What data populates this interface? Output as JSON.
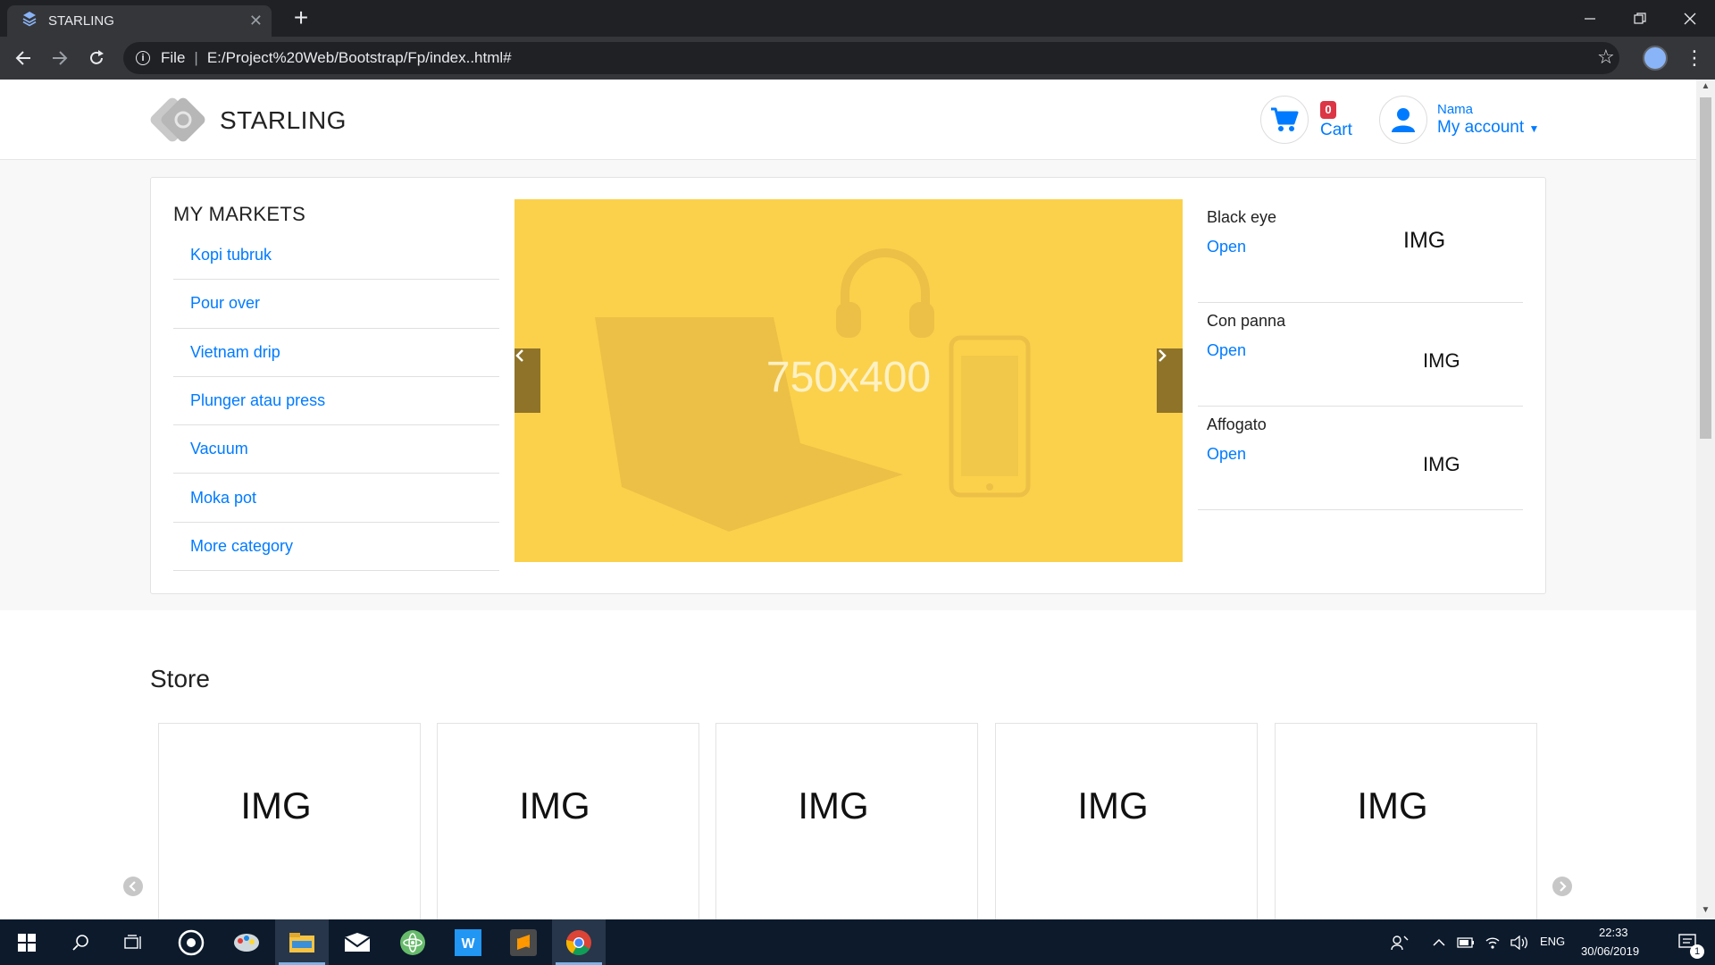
{
  "browser": {
    "tab_title": "STARLING",
    "tab_close": "✕",
    "new_tab": "+",
    "protocol": "File",
    "separator": "|",
    "url": "E:/Project%20Web/Bootstrap/Fp/index..html#",
    "icons": [
      "site-favicon",
      "back-icon",
      "forward-icon",
      "reload-icon",
      "info-icon",
      "star-icon",
      "profile-icon",
      "menu-icon",
      "minimize-icon",
      "restore-icon",
      "close-icon"
    ]
  },
  "header": {
    "brand": "STARLING",
    "cart_count": "0",
    "cart_label": "Cart",
    "account_name": "Nama",
    "account_label": "My account"
  },
  "markets": {
    "title": "MY MARKETS",
    "items": [
      {
        "label": "Kopi tubruk"
      },
      {
        "label": "Pour over"
      },
      {
        "label": "Vietnam drip"
      },
      {
        "label": "Plunger atau press"
      },
      {
        "label": "Vacuum"
      },
      {
        "label": "Moka pot"
      },
      {
        "label": "More category"
      }
    ]
  },
  "carousel": {
    "label": "750x400",
    "background": "#fbd14b"
  },
  "promos": [
    {
      "name": "Black eye",
      "link": "Open",
      "img": "IMG"
    },
    {
      "name": "Con panna",
      "link": "Open",
      "img": "IMG"
    },
    {
      "name": "Affogato",
      "link": "Open",
      "img": "IMG"
    }
  ],
  "store": {
    "title": "Store",
    "cards": [
      {
        "img": "IMG"
      },
      {
        "img": "IMG"
      },
      {
        "img": "IMG"
      },
      {
        "img": "IMG"
      },
      {
        "img": "IMG"
      }
    ]
  },
  "taskbar": {
    "language": "ENG",
    "time": "22:33",
    "date": "30/06/2019",
    "notification_count": "1"
  },
  "colors": {
    "link": "#007bff",
    "badge": "#dc3545",
    "carousel_bg": "#fbd14b",
    "chrome_dark": "#202124",
    "taskbar": "#0c1a2c"
  }
}
